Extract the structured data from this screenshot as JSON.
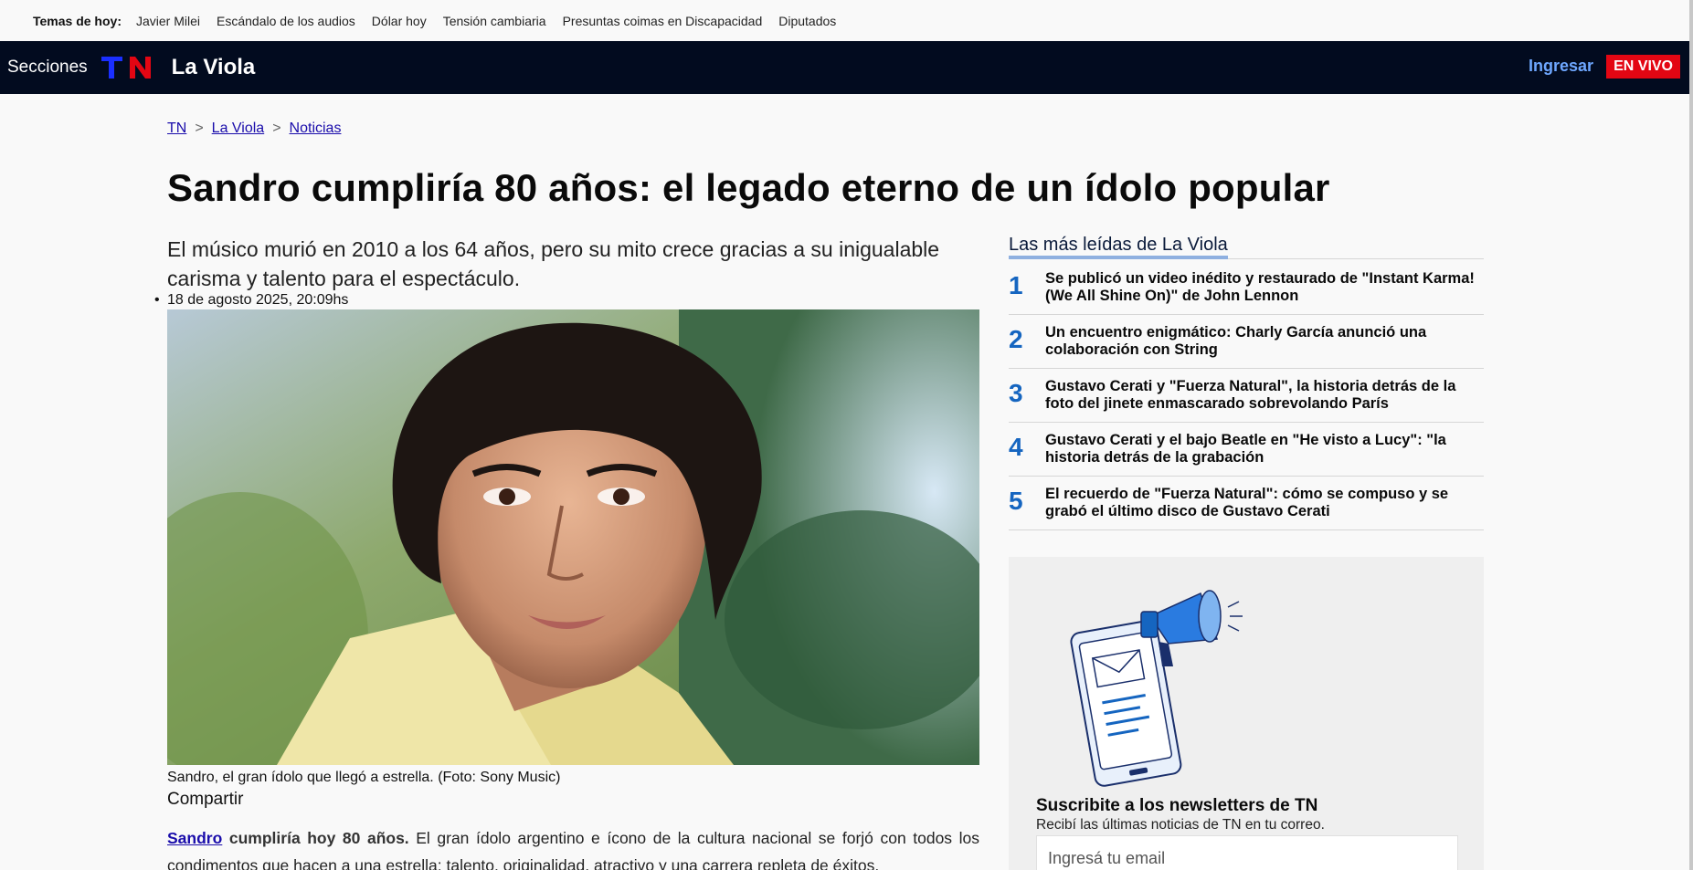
{
  "topics": {
    "label": "Temas de hoy:",
    "items": [
      "Javier Milei",
      "Escándalo de los audios",
      "Dólar hoy",
      "Tensión cambiaria",
      "Presuntas coimas en Discapacidad",
      "Diputados"
    ]
  },
  "header": {
    "sections_label": "Secciones",
    "logo_text": "TN",
    "section_name": "La Viola",
    "login_label": "Ingresar",
    "live_label": "EN VIVO"
  },
  "breadcrumb": [
    "TN",
    "La Viola",
    "Noticias"
  ],
  "article": {
    "headline": "Sandro cumpliría 80 años: el legado eterno de un ídolo popular",
    "subtitle": "El músico murió en 2010 a los 64 años, pero su mito crece gracias a su inigualable carisma y talento para el espectáculo.",
    "date": "18 de agosto 2025, 20:09hs",
    "photo_caption": "Sandro, el gran ídolo que llegó a estrella. (Foto: Sony Music)",
    "share_label": "Compartir",
    "body_link": "Sandro",
    "body_bold": "cumpliría hoy 80 años.",
    "body_rest": "El gran ídolo argentino e ícono de la cultura nacional se forjó con todos los condimentos que hacen a una estrella: talento, originalidad, atractivo y una carrera repleta de éxitos."
  },
  "most_read": {
    "title": "Las más leídas de La Viola",
    "items": [
      {
        "num": "1",
        "text": "Se publicó un video inédito y restaurado de \"Instant Karma! (We All Shine On)\" de John Lennon"
      },
      {
        "num": "2",
        "text": "Un encuentro enigmático: Charly García anunció una colaboración con String"
      },
      {
        "num": "3",
        "text": "Gustavo Cerati y \"Fuerza Natural\", la historia detrás de la foto del jinete enmascarado sobrevolando París"
      },
      {
        "num": "4",
        "text": "Gustavo Cerati y el bajo Beatle en \"He visto a Lucy\": \"la historia detrás de la grabación"
      },
      {
        "num": "5",
        "text": "El recuerdo de \"Fuerza Natural\": cómo se compuso y se grabó el último disco de Gustavo Cerati"
      }
    ]
  },
  "newsletter": {
    "title": "Suscribite a los newsletters de TN",
    "subtitle": "Recibí las últimas noticias de TN en tu correo.",
    "email_placeholder": "Ingresá tu email"
  },
  "colors": {
    "header_bg": "#020b1f",
    "accent_blue": "#1565c0",
    "live_red": "#e30613",
    "logo_blue": "#1a2fff",
    "logo_red": "#e30613"
  }
}
